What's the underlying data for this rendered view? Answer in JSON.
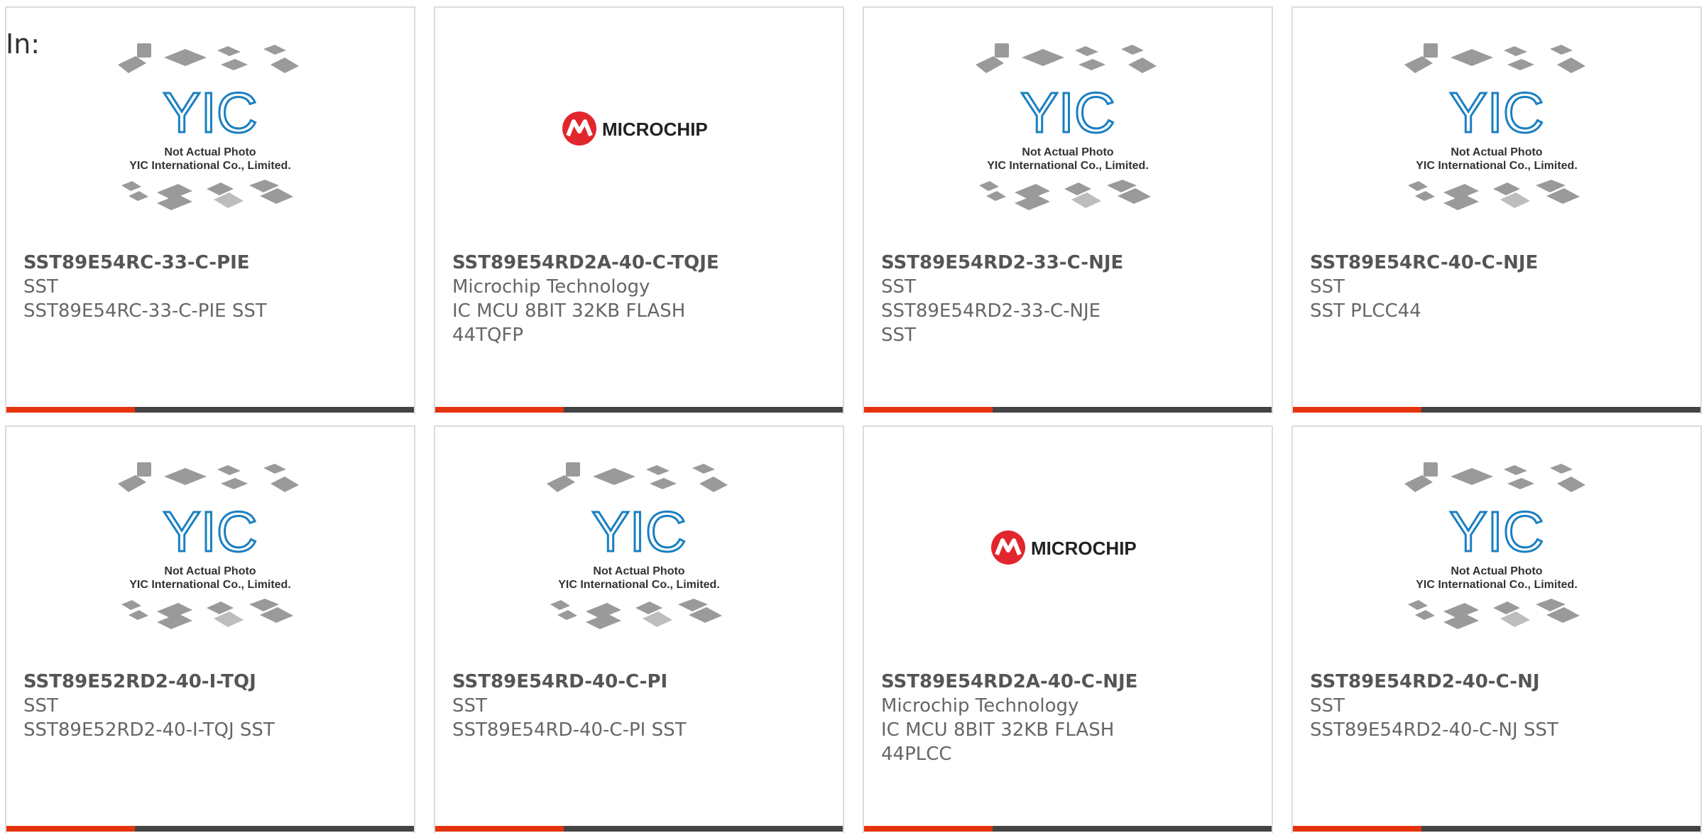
{
  "filter_label": "In:",
  "placeholder_text": {
    "line1": "Not Actual Photo",
    "line2": "YIC International Co., Limited.",
    "logo": "YIC"
  },
  "microchip_logo_text": "MICROCHIP",
  "colors": {
    "accent_orange": "#e4330d",
    "bar_dark": "#444444",
    "yic_blue": "#1a7fc1",
    "microchip_red": "#e1262d"
  },
  "products": [
    {
      "part": "SST89E54RC-33-C-PIE",
      "maker": "SST",
      "desc": "SST89E54RC-33-C-PIE SST",
      "image": "yic-placeholder"
    },
    {
      "part": "SST89E54RD2A-40-C-TQJE",
      "maker": "Microchip Technology",
      "desc": "IC MCU 8BIT 32KB FLASH 44TQFP",
      "image": "microchip-logo"
    },
    {
      "part": "SST89E54RD2-33-C-NJE",
      "maker": "SST",
      "desc": "SST89E54RD2-33-C-NJE SST",
      "image": "yic-placeholder"
    },
    {
      "part": "SST89E54RC-40-C-NJE",
      "maker": "SST",
      "desc": "SST PLCC44",
      "image": "yic-placeholder"
    },
    {
      "part": "SST89E52RD2-40-I-TQJ",
      "maker": "SST",
      "desc": "SST89E52RD2-40-I-TQJ SST",
      "image": "yic-placeholder"
    },
    {
      "part": "SST89E54RD-40-C-PI",
      "maker": "SST",
      "desc": "SST89E54RD-40-C-PI SST",
      "image": "yic-placeholder"
    },
    {
      "part": "SST89E54RD2A-40-C-NJE",
      "maker": "Microchip Technology",
      "desc": "IC MCU 8BIT 32KB FLASH 44PLCC",
      "image": "microchip-logo"
    },
    {
      "part": "SST89E54RD2-40-C-NJ",
      "maker": "SST",
      "desc": "SST89E54RD2-40-C-NJ SST",
      "image": "yic-placeholder"
    }
  ]
}
